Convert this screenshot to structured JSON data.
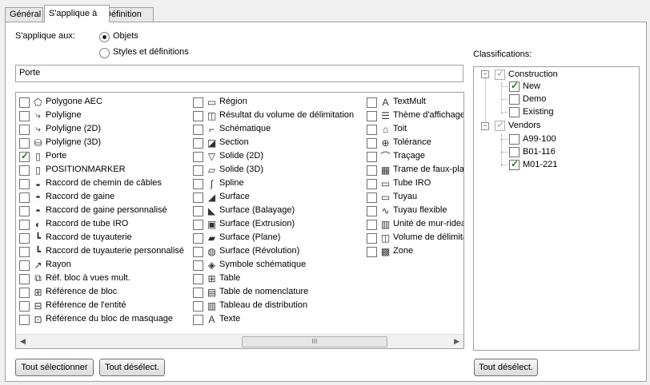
{
  "tabs": [
    "Général",
    "S'applique à",
    "Définition"
  ],
  "applies_to_label": "S'applique aux:",
  "radio_objects": "Objets",
  "radio_styles": "Styles et définitions",
  "text_value": "Porte",
  "classifications_label": "Classifications:",
  "col1": [
    {
      "label": "Polygone AEC",
      "checked": false,
      "icon": "polygon-icon"
    },
    {
      "label": "Polyligne",
      "checked": false,
      "icon": "polyline-icon"
    },
    {
      "label": "Polyligne (2D)",
      "checked": false,
      "icon": "polyline-2d-icon"
    },
    {
      "label": "Polyligne (3D)",
      "checked": false,
      "icon": "polyline-3d-icon"
    },
    {
      "label": "Porte",
      "checked": true,
      "icon": "door-icon"
    },
    {
      "label": "POSITIONMARKER",
      "checked": false,
      "icon": "position-marker-icon"
    },
    {
      "label": "Raccord de chemin de câbles",
      "checked": false,
      "icon": "cable-fitting-icon"
    },
    {
      "label": "Raccord de gaine",
      "checked": false,
      "icon": "duct-fitting-icon"
    },
    {
      "label": "Raccord de gaine personnalisé",
      "checked": false,
      "icon": "custom-duct-fitting-icon"
    },
    {
      "label": "Raccord de tube IRO",
      "checked": false,
      "icon": "conduit-fitting-icon"
    },
    {
      "label": "Raccord de tuyauterie",
      "checked": false,
      "icon": "pipe-fitting-icon"
    },
    {
      "label": "Raccord de tuyauterie personnalisé",
      "checked": false,
      "icon": "custom-pipe-fitting-icon"
    },
    {
      "label": "Rayon",
      "checked": false,
      "icon": "ray-icon"
    },
    {
      "label": "Réf. bloc à vues mult.",
      "checked": false,
      "icon": "multiview-block-icon"
    },
    {
      "label": "Référence de bloc",
      "checked": false,
      "icon": "block-reference-icon"
    },
    {
      "label": "Référence de l'entité",
      "checked": false,
      "icon": "entity-reference-icon"
    },
    {
      "label": "Référence du bloc de masquage",
      "checked": false,
      "icon": "mask-block-icon"
    }
  ],
  "col2": [
    {
      "label": "Région",
      "checked": false,
      "icon": "region-icon"
    },
    {
      "label": "Résultat du volume de délimitation",
      "checked": false,
      "icon": "bounding-volume-icon"
    },
    {
      "label": "Schématique",
      "checked": false,
      "icon": "schematic-icon"
    },
    {
      "label": "Section",
      "checked": false,
      "icon": "section-icon"
    },
    {
      "label": "Solide (2D)",
      "checked": false,
      "icon": "solid-2d-icon"
    },
    {
      "label": "Solide (3D)",
      "checked": false,
      "icon": "solid-3d-icon"
    },
    {
      "label": "Spline",
      "checked": false,
      "icon": "spline-icon"
    },
    {
      "label": "Surface",
      "checked": false,
      "icon": "surface-icon"
    },
    {
      "label": "Surface (Balayage)",
      "checked": false,
      "icon": "sweep-surface-icon"
    },
    {
      "label": "Surface (Extrusion)",
      "checked": false,
      "icon": "extrusion-surface-icon"
    },
    {
      "label": "Surface (Plane)",
      "checked": false,
      "icon": "plane-surface-icon"
    },
    {
      "label": "Surface (Révolution)",
      "checked": false,
      "icon": "revolution-surface-icon"
    },
    {
      "label": "Symbole schématique",
      "checked": false,
      "icon": "schematic-symbol-icon"
    },
    {
      "label": "Table",
      "checked": false,
      "icon": "table-icon"
    },
    {
      "label": "Table de nomenclature",
      "checked": false,
      "icon": "schedule-table-icon"
    },
    {
      "label": "Tableau de distribution",
      "checked": false,
      "icon": "panelboard-icon"
    },
    {
      "label": "Texte",
      "checked": false,
      "icon": "text-icon"
    }
  ],
  "col3": [
    {
      "label": "TextMult",
      "checked": false,
      "icon": "mtext-icon"
    },
    {
      "label": "Thème d'affichage",
      "checked": false,
      "icon": "display-theme-icon"
    },
    {
      "label": "Toit",
      "checked": false,
      "icon": "roof-icon"
    },
    {
      "label": "Tolérance",
      "checked": false,
      "icon": "tolerance-icon"
    },
    {
      "label": "Traçage",
      "checked": false,
      "icon": "trace-icon"
    },
    {
      "label": "Trame de faux-plafond",
      "checked": false,
      "icon": "ceiling-grid-icon"
    },
    {
      "label": "Tube IRO",
      "checked": false,
      "icon": "conduit-icon"
    },
    {
      "label": "Tuyau",
      "checked": false,
      "icon": "pipe-icon"
    },
    {
      "label": "Tuyau flexible",
      "checked": false,
      "icon": "flex-pipe-icon"
    },
    {
      "label": "Unité de mur-rideau",
      "checked": false,
      "icon": "curtain-wall-unit-icon"
    },
    {
      "label": "Volume de délimitation",
      "checked": false,
      "icon": "bounding-volume-icon"
    },
    {
      "label": "Zone",
      "checked": false,
      "icon": "zone-icon"
    }
  ],
  "tree": {
    "construction": {
      "label": "Construction",
      "children": [
        {
          "label": "New",
          "checked": true
        },
        {
          "label": "Demo",
          "checked": false
        },
        {
          "label": "Existing",
          "checked": false
        }
      ]
    },
    "vendors": {
      "label": "Vendors",
      "children": [
        {
          "label": "A99-100",
          "checked": false
        },
        {
          "label": "B01-116",
          "checked": false
        },
        {
          "label": "M01-221",
          "checked": true
        }
      ]
    }
  },
  "buttons": {
    "select_all": "Tout sélectionner",
    "deselect_all": "Tout désélect.",
    "deselect_all_right": "Tout désélect."
  },
  "scroll_thumb_glyph": "III"
}
